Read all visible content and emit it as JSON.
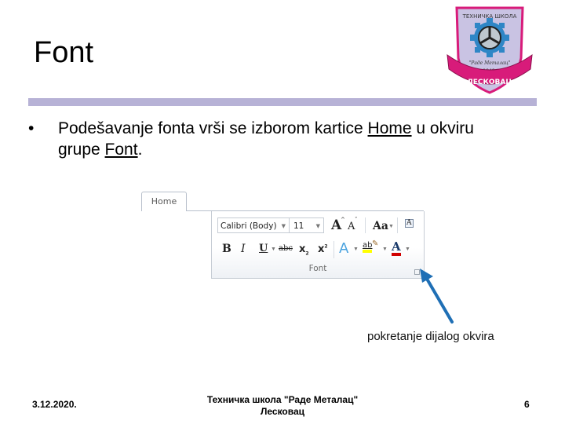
{
  "slide": {
    "title": "Font",
    "bullet": {
      "prefix": "Podešavanje fonta vrši se izborom kartice ",
      "link1": "Home",
      "middle": " u okviru grupe ",
      "link2": "Font",
      "suffix": "."
    },
    "logo": {
      "top_text": "ТЕХНИЧКА ШКОЛА",
      "name_text": "\"Раде Металац\"",
      "year": "1948.",
      "banner_text": "ЛЕСКОВАЦ",
      "colors": {
        "shield": "#c9c3e3",
        "banner": "#d81b7a",
        "gear": "#2f86c6"
      }
    },
    "ribbon": {
      "tab_label": "Home",
      "font_name": "Calibri (Body)",
      "font_size": "11",
      "row1_icons": [
        "grow-font-icon",
        "shrink-font-icon",
        "change-case-icon",
        "clear-formatting-icon"
      ],
      "row1_glyphs": {
        "grow": "A",
        "shrink": "A",
        "case": "Aa",
        "clear": "A"
      },
      "row2_glyphs": {
        "bold": "B",
        "italic": "I",
        "underline": "U",
        "strike": "abc",
        "subscript": "x",
        "superscript": "x",
        "effects": "A",
        "highlight": "ab",
        "fontcolor": "A"
      },
      "group_label": "Font",
      "colors": {
        "highlight": "#ffff00",
        "font_color": "#d00000",
        "text_effect": "#4aa3df"
      }
    },
    "annotation": {
      "caption": "pokretanje dijalog okvira",
      "arrow_color": "#1f6fb5"
    },
    "footer": {
      "date": "3.12.2020.",
      "school_line1": "Техничка школа \"Раде Металац\"",
      "school_line2": "Лесковац",
      "page_number": "6"
    },
    "accent_rule_color": "#b7b2d6"
  }
}
